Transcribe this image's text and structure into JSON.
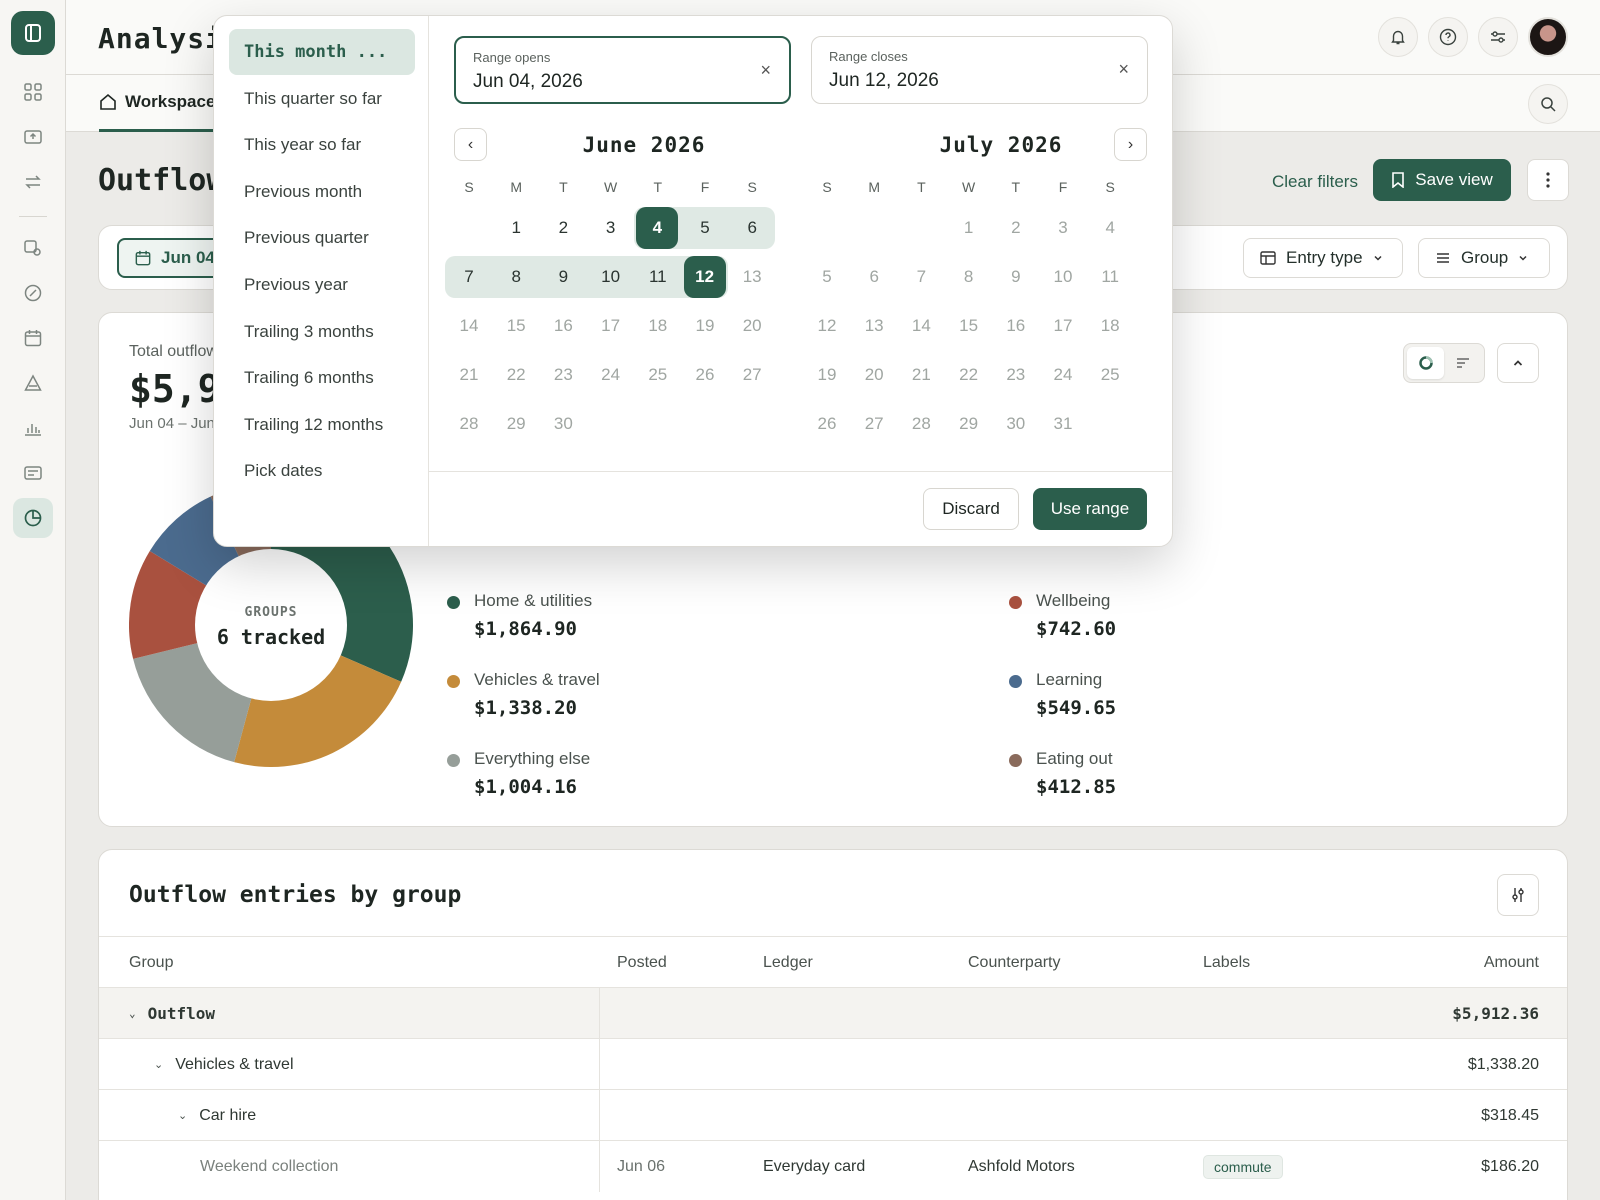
{
  "header": {
    "title": "Analysis"
  },
  "subnav": {
    "tab_label": "Workspace"
  },
  "section": {
    "title": "Outflow",
    "clear_filters": "Clear filters",
    "save_view": "Save view"
  },
  "filters": {
    "date_chip": "Jun 04",
    "entry_type": "Entry type",
    "group": "Group"
  },
  "summary": {
    "total_label": "Total outflow",
    "total_value": "$5,912.36",
    "range_text": "Jun 04 – Jun 12",
    "donut_center_label": "GROUPS",
    "donut_center_value": "6 tracked",
    "groups": [
      {
        "name": "Home & utilities",
        "amount": "$1,864.90",
        "value": 1864.9,
        "color": "#2c5e4c"
      },
      {
        "name": "Vehicles & travel",
        "amount": "$1,338.20",
        "value": 1338.2,
        "color": "#c48b3a"
      },
      {
        "name": "Everything else",
        "amount": "$1,004.16",
        "value": 1004.16,
        "color": "#969e99"
      },
      {
        "name": "Wellbeing",
        "amount": "$742.60",
        "value": 742.6,
        "color": "#a9513f"
      },
      {
        "name": "Learning",
        "amount": "$549.65",
        "value": 549.65,
        "color": "#4b6b8e"
      },
      {
        "name": "Eating out",
        "amount": "$412.85",
        "value": 412.85,
        "color": "#8a6b5c"
      }
    ]
  },
  "table": {
    "title": "Outflow entries by group",
    "columns": [
      "Group",
      "Posted",
      "Ledger",
      "Counterparty",
      "Labels",
      "Amount"
    ],
    "rows": [
      {
        "group": "Outflow",
        "amount": "$5,912.36"
      },
      {
        "group": "Vehicles & travel",
        "amount": "$1,338.20"
      },
      {
        "group": "Car hire",
        "amount": "$318.45"
      },
      {
        "group": "Weekend collection",
        "posted": "Jun 06",
        "ledger": "Everyday card",
        "counterparty": "Ashfold Motors",
        "label": "commute",
        "amount": "$186.20"
      }
    ]
  },
  "picker": {
    "presets": [
      "This month ...",
      "This quarter so far",
      "This year so far",
      "Previous month",
      "Previous quarter",
      "Previous year",
      "Trailing 3 months",
      "Trailing 6 months",
      "Trailing 12 months",
      "Pick dates"
    ],
    "selected_preset": 0,
    "range_opens_label": "Range opens",
    "range_opens_value": "Jun 04, 2026",
    "range_closes_label": "Range closes",
    "range_closes_value": "Jun 12, 2026",
    "clear_glyph": "×",
    "prev_glyph": "‹",
    "next_glyph": "›",
    "weekdays": [
      "S",
      "M",
      "T",
      "W",
      "T",
      "F",
      "S"
    ],
    "months": [
      {
        "title": "June 2026",
        "first_weekday": 1,
        "days": 30,
        "active_through": 12
      },
      {
        "title": "July 2026",
        "first_weekday": 3,
        "days": 31,
        "active_through": 0
      }
    ],
    "range_start_day": 4,
    "range_end_day": 12,
    "discard": "Discard",
    "use_range": "Use range"
  },
  "icons": {
    "logo": "panel-icon",
    "nav": [
      "grid-icon",
      "inbox-icon",
      "transfer-icon",
      "wallet-icon",
      "gauge-icon",
      "calendar-icon",
      "triangle-icon",
      "bar-chart-icon",
      "card-icon",
      "pie-chart-icon"
    ]
  }
}
